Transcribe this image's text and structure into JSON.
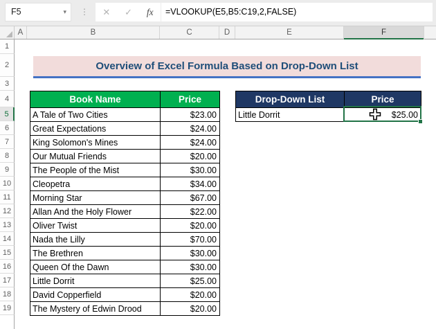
{
  "formula_bar": {
    "cell_reference": "F5",
    "namebox_dropdown": "▾",
    "cancel_icon": "✕",
    "enter_icon": "✓",
    "fx_icon": "fx",
    "formula": "=VLOOKUP(E5,B5:C19,2,FALSE)"
  },
  "sheet": {
    "column_headers": [
      "A",
      "B",
      "C",
      "D",
      "E",
      "F"
    ],
    "selected_column": "F",
    "row_headers": [
      "1",
      "2",
      "3",
      "4",
      "5",
      "6",
      "7",
      "8",
      "9",
      "10",
      "11",
      "12",
      "13",
      "14",
      "15",
      "16",
      "17",
      "18",
      "19"
    ],
    "selected_row": "5",
    "selected_cell": "F5"
  },
  "title": {
    "text": "Overview of Excel Formula Based on Drop-Down List"
  },
  "book_table": {
    "name_header": "Book Name",
    "price_header": "Price",
    "rows": [
      {
        "name": "A Tale of Two Cities",
        "price": "$23.00"
      },
      {
        "name": "Great Expectations",
        "price": "$24.00"
      },
      {
        "name": "King Solomon's Mines",
        "price": "$24.00"
      },
      {
        "name": "Our Mutual Friends",
        "price": "$20.00"
      },
      {
        "name": "The People of the Mist",
        "price": "$30.00"
      },
      {
        "name": "Cleopetra",
        "price": "$34.00"
      },
      {
        "name": "Morning Star",
        "price": "$67.00"
      },
      {
        "name": "Allan And the Holy Flower",
        "price": "$22.00"
      },
      {
        "name": "Oliver Twist",
        "price": "$20.00"
      },
      {
        "name": "Nada the Lilly",
        "price": "$70.00"
      },
      {
        "name": "The Brethren",
        "price": "$30.00"
      },
      {
        "name": "Queen Of the Dawn",
        "price": "$30.00"
      },
      {
        "name": "Little Dorrit",
        "price": "$25.00"
      },
      {
        "name": "David Copperfield",
        "price": "$20.00"
      },
      {
        "name": "The Mystery of Edwin Drood",
        "price": "$20.00"
      }
    ]
  },
  "lookup_table": {
    "dropdown_header": "Drop-Down List",
    "price_header": "Price",
    "row": {
      "book": "Little Dorrit",
      "price": "$25.00"
    }
  },
  "colors": {
    "book_header_bg": "#00B050",
    "lookup_header_bg": "#1F3864",
    "title_bg": "#F2DCDB",
    "title_text": "#1F4E79",
    "title_underline": "#4472C4",
    "selection_green": "#217346"
  }
}
